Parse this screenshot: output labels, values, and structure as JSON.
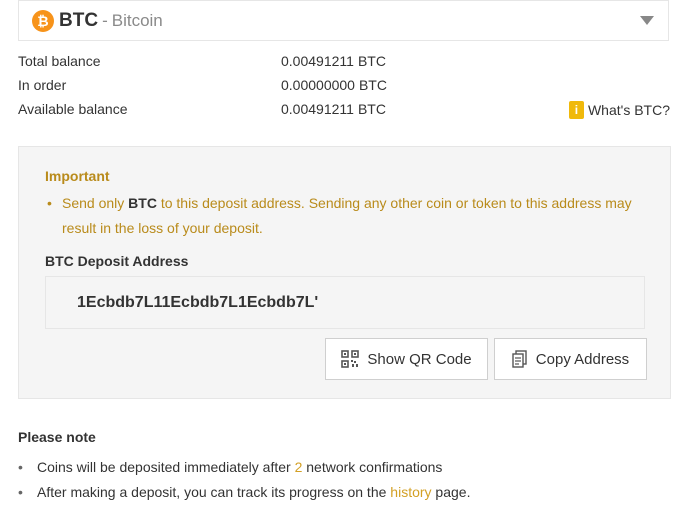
{
  "coin_selector": {
    "symbol": "BTC",
    "dash": "-",
    "name": "Bitcoin",
    "icon": "bitcoin-icon",
    "icon_glyph": "₿",
    "icon_color": "#f7931a"
  },
  "balances": [
    {
      "label": "Total balance",
      "amount": "0.00491211",
      "unit": "BTC"
    },
    {
      "label": "In order",
      "amount": "0.00000000",
      "unit": "BTC"
    },
    {
      "label": "Available balance",
      "amount": "0.00491211",
      "unit": "BTC"
    }
  ],
  "whats_btc": {
    "label": "What's BTC?",
    "icon": "info-book-icon",
    "icon_glyph": "i"
  },
  "important": {
    "title": "Important",
    "bullet": "•",
    "text_before": "Send only ",
    "coin": "BTC",
    "text_after": " to this deposit address. Sending any other coin or token to this address may result in the loss of your deposit.",
    "color": "#b98b1b"
  },
  "deposit": {
    "label": "BTC Deposit Address",
    "address": "1Ecbdb7L11Ecbdb7L1Ecbdb7L'"
  },
  "buttons": {
    "qr_label": "Show QR Code",
    "copy_label": "Copy Address"
  },
  "note": {
    "title": "Please note",
    "bullet": "•",
    "item1_before": "Coins will be deposited immediately after ",
    "item1_count": "2",
    "item1_after": " network confirmations",
    "item2_before": "After making a deposit, you can track its progress on the ",
    "item2_link": "history",
    "item2_after": " page."
  },
  "colors": {
    "accent": "#d3a024",
    "panel_bg": "#f5f5f5"
  }
}
